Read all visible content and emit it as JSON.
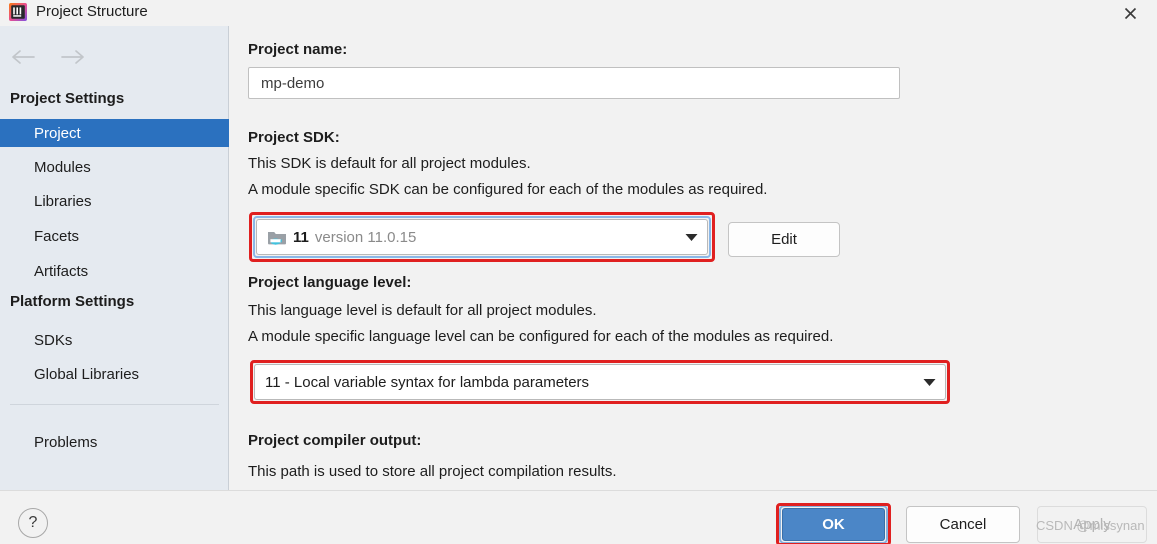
{
  "window": {
    "title": "Project Structure",
    "app_icon": "intellij-idea-logo",
    "close_icon": "close-icon"
  },
  "nav": {
    "back_icon": "arrow-left-icon",
    "forward_icon": "arrow-right-icon"
  },
  "sidebar": {
    "groups": [
      {
        "header": "Project Settings",
        "items": [
          {
            "label": "Project",
            "selected": true
          },
          {
            "label": "Modules",
            "selected": false
          },
          {
            "label": "Libraries",
            "selected": false
          },
          {
            "label": "Facets",
            "selected": false
          },
          {
            "label": "Artifacts",
            "selected": false
          }
        ]
      },
      {
        "header": "Platform Settings",
        "items": [
          {
            "label": "SDKs",
            "selected": false
          },
          {
            "label": "Global Libraries",
            "selected": false
          }
        ]
      }
    ],
    "footer_items": [
      {
        "label": "Problems",
        "selected": false
      }
    ]
  },
  "main": {
    "project_name": {
      "label": "Project name:",
      "value": "mp-demo",
      "placeholder": ""
    },
    "project_sdk": {
      "label": "Project SDK:",
      "desc_line1": "This SDK is default for all project modules.",
      "desc_line2": "A module specific SDK can be configured for each of the modules as required.",
      "selected_name": "11",
      "selected_version": "version 11.0.15",
      "sdk_icon": "java-sdk-folder-icon",
      "caret_icon": "chevron-down-icon",
      "edit_button": "Edit",
      "highlighted": true,
      "focused": true
    },
    "project_language_level": {
      "label": "Project language level:",
      "desc_line1": "This language level is default for all project modules.",
      "desc_line2": "A module specific language level can be configured for each of the modules as required.",
      "selected": "11 - Local variable syntax for lambda parameters",
      "caret_icon": "chevron-down-icon",
      "highlighted": true
    },
    "project_compiler_output": {
      "label": "Project compiler output:",
      "desc_line1": "This path is used to store all project compilation results."
    }
  },
  "footer": {
    "help_label": "?",
    "help_icon": "question-mark-icon",
    "ok_label": "OK",
    "ok_highlighted": true,
    "cancel_label": "Cancel",
    "apply_label": "Apply",
    "apply_disabled": true,
    "watermark": "CSDN @missynan"
  },
  "colors": {
    "accent_selection": "#2b71bf",
    "ok_button": "#4b86c7",
    "annotation_red": "#e02020",
    "sidebar_bg": "#e5eaf0",
    "panel_bg": "#f2f2f2"
  }
}
